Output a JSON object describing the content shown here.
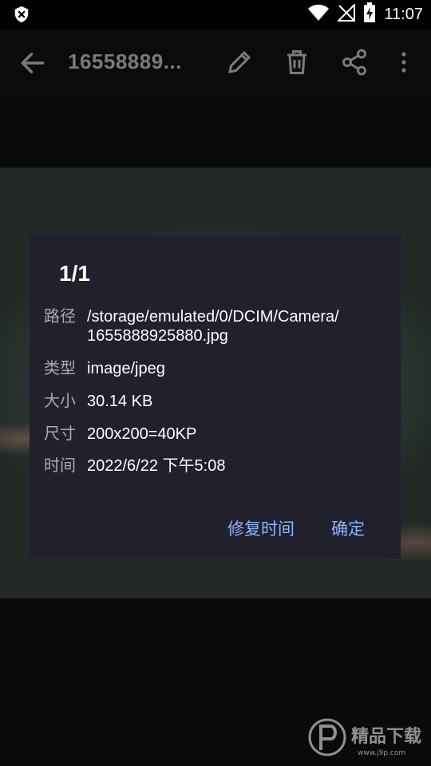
{
  "status_bar": {
    "time": "11:07"
  },
  "app_bar": {
    "title": "16558889..."
  },
  "dialog": {
    "title": "1/1",
    "rows": [
      {
        "label": "路径",
        "value": "/storage/emulated/0/DCIM/Camera/\n1655888925880.jpg"
      },
      {
        "label": "类型",
        "value": "image/jpeg"
      },
      {
        "label": "大小",
        "value": "30.14 KB"
      },
      {
        "label": "尺寸",
        "value": "200x200=40KP"
      },
      {
        "label": "时间",
        "value": "2022/6/22 下午5:08"
      }
    ],
    "fix_time_label": "修复时间",
    "ok_label": "确定"
  },
  "watermark": {
    "text": "精品下载",
    "url_text": "www.j9p.com"
  },
  "colors": {
    "dialog_bg": "#20212c",
    "accent": "#8fb4ff"
  }
}
